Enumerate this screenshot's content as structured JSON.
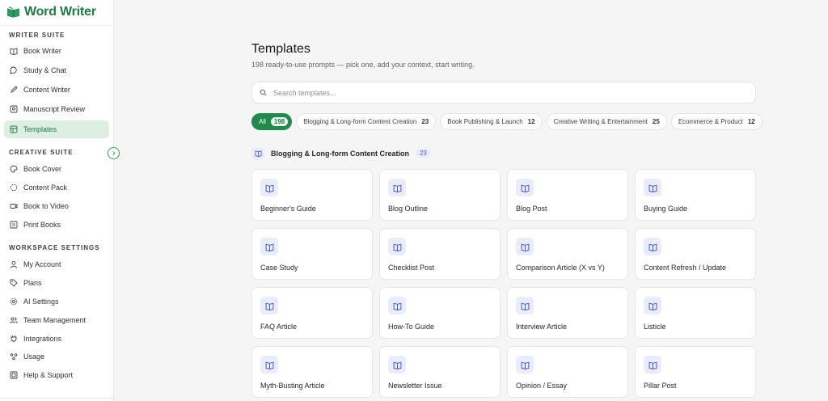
{
  "brand": {
    "name": "Word Writer"
  },
  "sidebar": {
    "sections": [
      {
        "title": "WRITER SUITE",
        "items": [
          {
            "label": "Book Writer",
            "icon": "book-icon"
          },
          {
            "label": "Study & Chat",
            "icon": "chat-icon"
          },
          {
            "label": "Content Writer",
            "icon": "pen-icon"
          },
          {
            "label": "Manuscript Review",
            "icon": "review-icon"
          },
          {
            "label": "Templates",
            "icon": "templates-icon",
            "active": true
          }
        ]
      },
      {
        "title": "CREATIVE SUITE",
        "items": [
          {
            "label": "Book Cover",
            "icon": "palette-icon"
          },
          {
            "label": "Content Pack",
            "icon": "pack-icon"
          },
          {
            "label": "Book to Video",
            "icon": "video-icon"
          },
          {
            "label": "Print Books",
            "icon": "print-icon"
          }
        ]
      },
      {
        "title": "WORKSPACE SETTINGS",
        "items": [
          {
            "label": "My Account",
            "icon": "user-icon"
          },
          {
            "label": "Plans",
            "icon": "tag-icon"
          },
          {
            "label": "AI Settings",
            "icon": "settings-icon"
          },
          {
            "label": "Team Management",
            "icon": "team-icon"
          },
          {
            "label": "Integrations",
            "icon": "plug-icon"
          },
          {
            "label": "Usage",
            "icon": "usage-icon"
          },
          {
            "label": "Help & Support",
            "icon": "help-icon"
          }
        ]
      }
    ]
  },
  "main": {
    "title": "Templates",
    "subtitle": "198 ready-to-use prompts — pick one, add your context, start writing.",
    "search_placeholder": "Search templates...",
    "chips": [
      {
        "label": "All",
        "count": "198",
        "active": true
      },
      {
        "label": "Blogging & Long-form Content Creation",
        "count": "23"
      },
      {
        "label": "Book Publishing & Launch",
        "count": "12"
      },
      {
        "label": "Creative Writing & Entertainment",
        "count": "25"
      },
      {
        "label": "Ecommerce & Product",
        "count": "12"
      }
    ],
    "group": {
      "title": "Blogging & Long-form Content Creation",
      "count": "23"
    },
    "cards": [
      "Beginner's Guide",
      "Blog Outline",
      "Blog Post",
      "Buying Guide",
      "Case Study",
      "Checklist Post",
      "Comparison Article (X vs Y)",
      "Content Refresh / Update",
      "FAQ Article",
      "How-To Guide",
      "Interview Article",
      "Listicle",
      "Myth-Busting Article",
      "Newsletter Issue",
      "Opinion / Essay",
      "Pillar Post"
    ]
  },
  "colors": {
    "accent": "#1f8a4c",
    "accent_light": "#dcefe2",
    "icon_bg": "#e9edfb",
    "icon_fg": "#4856c9"
  }
}
